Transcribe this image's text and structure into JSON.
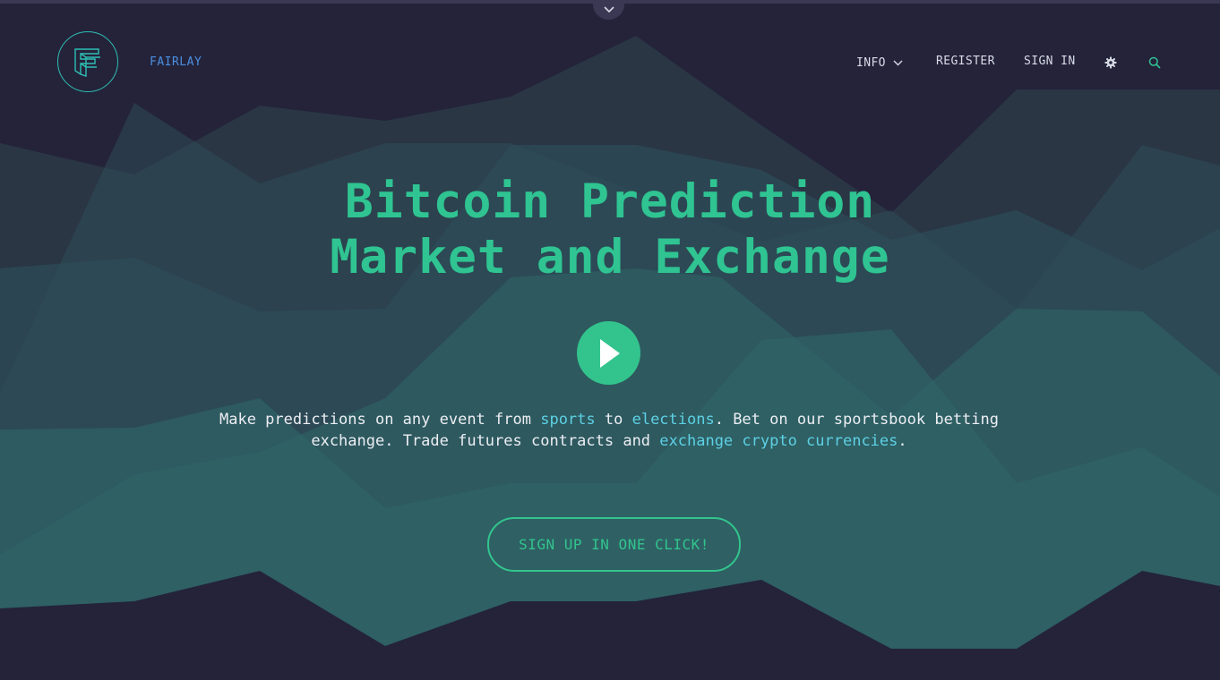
{
  "brand": {
    "name": "FAIRLAY"
  },
  "nav": {
    "info_label": "INFO",
    "register_label": "REGISTER",
    "signin_label": "SIGN IN",
    "settings_icon": "gear-icon",
    "search_icon": "search-icon"
  },
  "hero": {
    "title_line1": "Bitcoin Prediction",
    "title_line2": "Market and Exchange",
    "play_icon": "play-icon",
    "desc_part1": "Make predictions on any event from ",
    "desc_link_sports": "sports",
    "desc_part2": " to ",
    "desc_link_elections": "elections",
    "desc_part3": ". Bet on our sportsbook betting exchange. Trade futures contracts and ",
    "desc_link_crypto": "exchange crypto currencies",
    "desc_part4": ".",
    "cta_label": "SIGN UP IN ONE CLICK!"
  },
  "colors": {
    "background": "#24233a",
    "accent_green": "#2fc492",
    "link_cyan": "#5ed0e4",
    "brand_blue": "#4b8fe0"
  }
}
